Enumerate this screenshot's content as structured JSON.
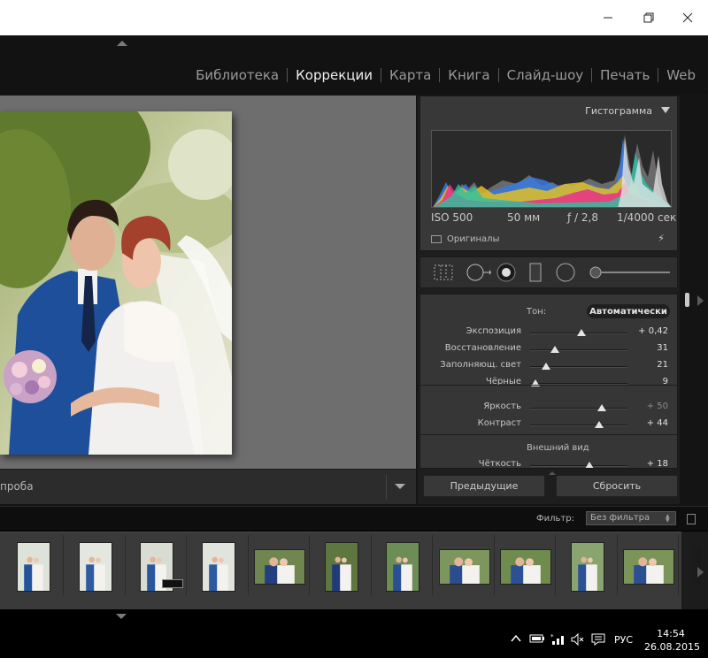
{
  "window": {
    "minimize_icon": "minimize-icon",
    "restore_icon": "restore-icon",
    "close_icon": "close-icon"
  },
  "modules": [
    "Библиотека",
    "Коррекции",
    "Карта",
    "Книга",
    "Слайд-шоу",
    "Печать",
    "Web"
  ],
  "active_module": "Коррекции",
  "preview": {
    "proof_label": "проба"
  },
  "histogram": {
    "title": "Гистограмма",
    "iso": "ISO 500",
    "focal": "50 мм",
    "aperture": "ƒ / 2,8",
    "shutter": "1/4000 сек",
    "originals_label": "Оригиналы"
  },
  "basic": {
    "tone_label": "Тон:",
    "auto_label": "Автоматически",
    "rows": [
      {
        "label": "Экспозиция",
        "value": "+ 0,42",
        "level": 0.53
      },
      {
        "label": "Восстановление",
        "value": "31",
        "level": 0.25
      },
      {
        "label": "Заполняющ. свет",
        "value": "21",
        "level": 0.16
      },
      {
        "label": "Чёрные",
        "value": "9",
        "level": 0.05
      }
    ],
    "rows2": [
      {
        "label": "Яркость",
        "value": "+ 50",
        "level": 0.74
      },
      {
        "label": "Контраст",
        "value": "+ 44",
        "level": 0.71
      }
    ],
    "presence_label": "Внешний вид",
    "rows3": [
      {
        "label": "Чёткость",
        "value": "+ 18",
        "level": 0.61
      }
    ]
  },
  "buttons": {
    "previous": "Предыдущие",
    "reset": "Сбросить"
  },
  "filter": {
    "label": "Фильтр:",
    "value": "Без фильтра"
  },
  "tray": {
    "lang": "РУС",
    "time": "14:54",
    "date": "26.08.2015"
  },
  "colors": {
    "accent_text": "#f0f0f0",
    "panel_bg": "#363636",
    "warning_yellow": "#e8c000"
  }
}
